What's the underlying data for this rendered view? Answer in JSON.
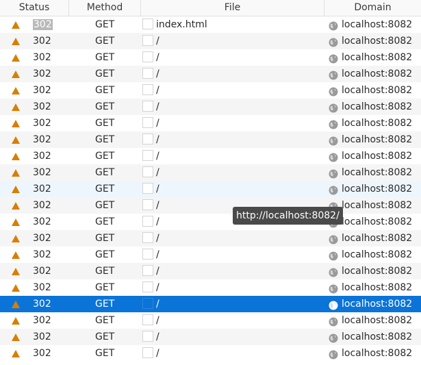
{
  "columns": {
    "status": "Status",
    "method": "Method",
    "file": "File",
    "domain": "Domain"
  },
  "requests": [
    {
      "status": "302",
      "method": "GET",
      "file": "index.html",
      "domain": "localhost:8082"
    },
    {
      "status": "302",
      "method": "GET",
      "file": "/",
      "domain": "localhost:8082"
    },
    {
      "status": "302",
      "method": "GET",
      "file": "/",
      "domain": "localhost:8082"
    },
    {
      "status": "302",
      "method": "GET",
      "file": "/",
      "domain": "localhost:8082"
    },
    {
      "status": "302",
      "method": "GET",
      "file": "/",
      "domain": "localhost:8082"
    },
    {
      "status": "302",
      "method": "GET",
      "file": "/",
      "domain": "localhost:8082"
    },
    {
      "status": "302",
      "method": "GET",
      "file": "/",
      "domain": "localhost:8082"
    },
    {
      "status": "302",
      "method": "GET",
      "file": "/",
      "domain": "localhost:8082"
    },
    {
      "status": "302",
      "method": "GET",
      "file": "/",
      "domain": "localhost:8082"
    },
    {
      "status": "302",
      "method": "GET",
      "file": "/",
      "domain": "localhost:8082"
    },
    {
      "status": "302",
      "method": "GET",
      "file": "/",
      "domain": "localhost:8082"
    },
    {
      "status": "302",
      "method": "GET",
      "file": "/",
      "domain": "localhost:8082"
    },
    {
      "status": "302",
      "method": "GET",
      "file": "/",
      "domain": "localhost:8082"
    },
    {
      "status": "302",
      "method": "GET",
      "file": "/",
      "domain": "localhost:8082"
    },
    {
      "status": "302",
      "method": "GET",
      "file": "/",
      "domain": "localhost:8082"
    },
    {
      "status": "302",
      "method": "GET",
      "file": "/",
      "domain": "localhost:8082"
    },
    {
      "status": "302",
      "method": "GET",
      "file": "/",
      "domain": "localhost:8082"
    },
    {
      "status": "302",
      "method": "GET",
      "file": "/",
      "domain": "localhost:8082",
      "selected": true
    },
    {
      "status": "302",
      "method": "GET",
      "file": "/",
      "domain": "localhost:8082"
    },
    {
      "status": "302",
      "method": "GET",
      "file": "/",
      "domain": "localhost:8082"
    },
    {
      "status": "302",
      "method": "GET",
      "file": "/",
      "domain": "localhost:8082"
    }
  ],
  "hovered_row": 10,
  "tooltip": "http://localhost:8082/",
  "icons": {
    "status": "warning-triangle-icon",
    "file": "file-thumbnail-icon",
    "domain": "globe-icon"
  },
  "colors": {
    "warning": "#d97e00",
    "selected_row": "#0a74d8",
    "hover_row": "#eef6fd",
    "tooltip_bg": "#4a4a4a"
  }
}
